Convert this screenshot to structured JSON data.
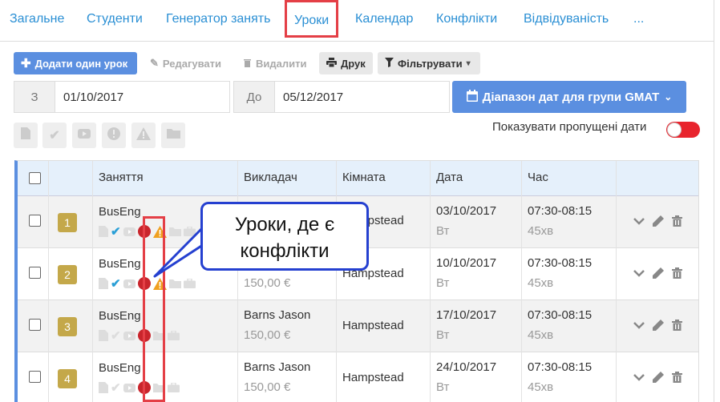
{
  "tabs": [
    {
      "label": "Загальне"
    },
    {
      "label": "Студенти"
    },
    {
      "label": "Генератор занять"
    },
    {
      "label": "Уроки"
    },
    {
      "label": "Календар"
    },
    {
      "label": "Конфлікти"
    },
    {
      "label": "Відвідуваність"
    },
    {
      "label": "..."
    }
  ],
  "toolbar": {
    "add_label": "Додати один урок",
    "edit_label": "Редагувати",
    "delete_label": "Видалити",
    "print_label": "Друк",
    "filter_label": "Фільтрувати"
  },
  "date_range": {
    "from_label": "З",
    "from_value": "01/10/2017",
    "to_label": "До",
    "to_value": "05/12/2017",
    "range_button": "Діапазон дат для групи GMAT"
  },
  "toggle": {
    "label": "Показувати пропущені дати",
    "on": true
  },
  "table": {
    "columns": [
      "Заняття",
      "Викладач",
      "Кімната",
      "Дата",
      "Час"
    ],
    "rows": [
      {
        "num": "1",
        "lesson": "BusEng",
        "teacher": "",
        "price": "",
        "room": "Hampstead",
        "date": "03/10/2017",
        "day": "Вт",
        "time": "07:30-08:15",
        "duration": "45хв"
      },
      {
        "num": "2",
        "lesson": "BusEng",
        "teacher": "",
        "price": "150,00 €",
        "room": "Hampstead",
        "date": "10/10/2017",
        "day": "Вт",
        "time": "07:30-08:15",
        "duration": "45хв"
      },
      {
        "num": "3",
        "lesson": "BusEng",
        "teacher": "Barns Jason",
        "price": "150,00 €",
        "room": "Hampstead",
        "date": "17/10/2017",
        "day": "Вт",
        "time": "07:30-08:15",
        "duration": "45хв"
      },
      {
        "num": "4",
        "lesson": "BusEng",
        "teacher": "Barns Jason",
        "price": "150,00 €",
        "room": "Hampstead",
        "date": "24/10/2017",
        "day": "Вт",
        "time": "07:30-08:15",
        "duration": "45хв"
      }
    ]
  },
  "callout": {
    "line1": "Уроки, де є",
    "line2": "конфлікти"
  },
  "colors": {
    "accent": "#5b8fe0",
    "highlight": "#e43f46",
    "callout_border": "#2540d0",
    "conflict": "#c9252c",
    "warning": "#f0a020",
    "check": "#2a9fd6",
    "badge": "#c4a84a"
  }
}
